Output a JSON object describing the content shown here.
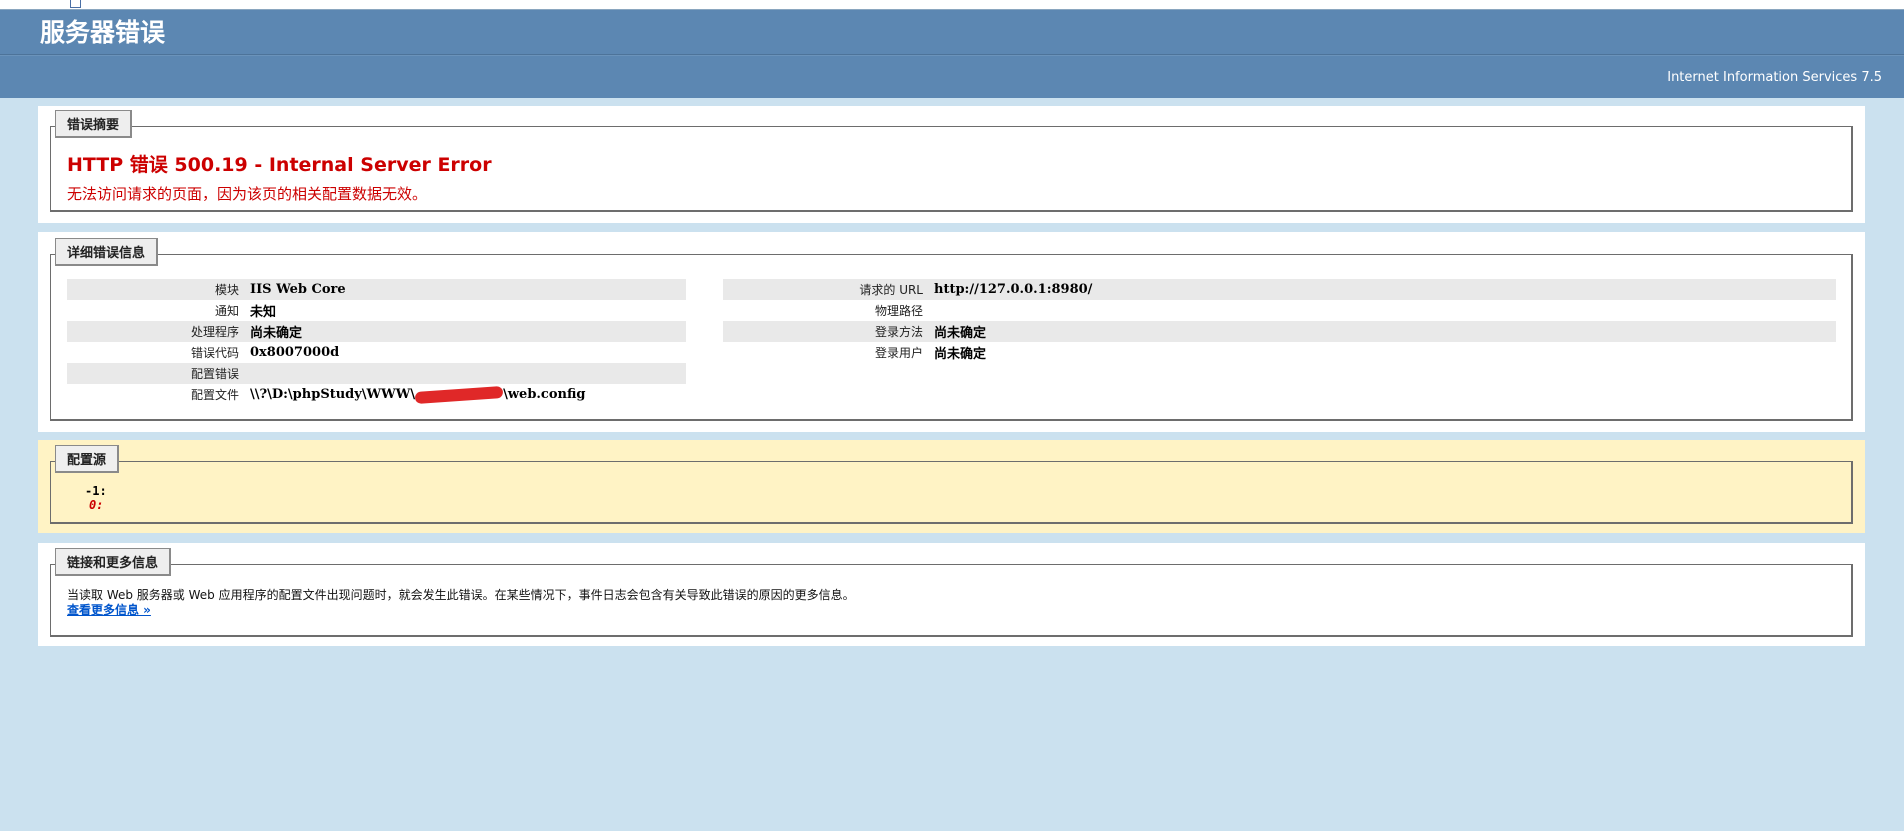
{
  "header": {
    "title": "服务器错误",
    "server": "Internet Information Services 7.5"
  },
  "summary": {
    "legend": "错误摘要",
    "title": "HTTP 错误 500.19 - Internal Server Error",
    "description": "无法访问请求的页面，因为该页的相关配置数据无效。"
  },
  "details": {
    "legend": "详细错误信息",
    "left": [
      {
        "label": "模块",
        "value": "IIS Web Core"
      },
      {
        "label": "通知",
        "value": "未知"
      },
      {
        "label": "处理程序",
        "value": "尚未确定"
      },
      {
        "label": "错误代码",
        "value": "0x8007000d"
      },
      {
        "label": "配置错误",
        "value": ""
      },
      {
        "label": "配置文件",
        "value_prefix": "\\\\?\\D:\\phpStudy\\WWW\\",
        "value_suffix": "\\web.config"
      }
    ],
    "right": [
      {
        "label": "请求的 URL",
        "value": "http://127.0.0.1:8980/"
      },
      {
        "label": "物理路径",
        "value": ""
      },
      {
        "label": "登录方法",
        "value": "尚未确定"
      },
      {
        "label": "登录用户",
        "value": "尚未确定"
      }
    ]
  },
  "config_source": {
    "legend": "配置源",
    "line1": "-1:",
    "line2": "0:"
  },
  "more_info": {
    "legend": "链接和更多信息",
    "text": "当读取 Web 服务器或 Web 应用程序的配置文件出现问题时，就会发生此错误。在某些情况下，事件日志会包含有关导致此错误的原因的更多信息。",
    "link": "查看更多信息 »"
  },
  "colors": {
    "background": "#CBE1EF",
    "header": "#5C87B2",
    "error_red": "#CC0000",
    "link": "#0055CC",
    "config_panel": "#FFF3C5"
  }
}
